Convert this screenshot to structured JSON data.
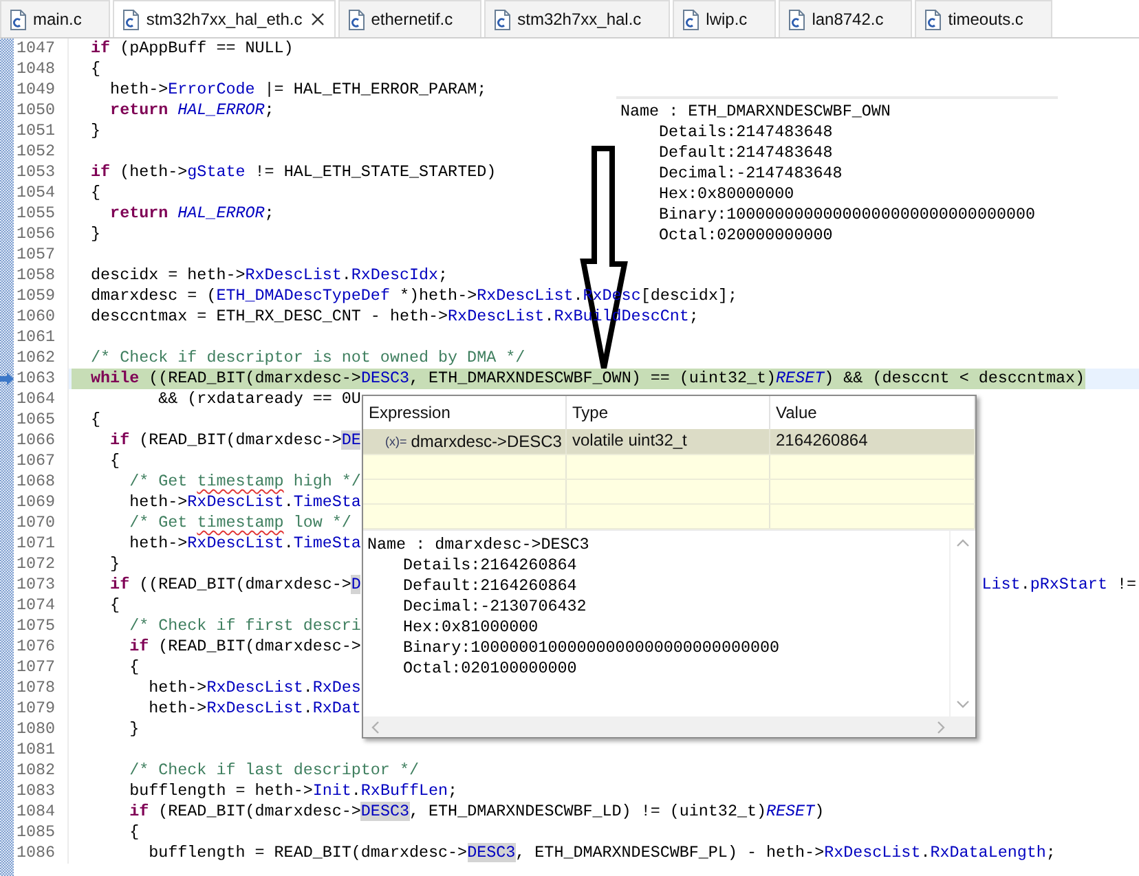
{
  "tabs": [
    {
      "label": "main.c",
      "selected": false
    },
    {
      "label": "stm32h7xx_hal_eth.c",
      "selected": true
    },
    {
      "label": "ethernetif.c",
      "selected": false
    },
    {
      "label": "stm32h7xx_hal.c",
      "selected": false
    },
    {
      "label": "lwip.c",
      "selected": false
    },
    {
      "label": "lan8742.c",
      "selected": false
    },
    {
      "label": "timeouts.c",
      "selected": false
    }
  ],
  "editor": {
    "lines": [
      {
        "number": "1047",
        "current": false,
        "segments": [
          {
            "text": "  if",
            "kind": "keyword"
          },
          {
            "text": " (pAppBuff == NULL)",
            "kind": "plain"
          }
        ]
      },
      {
        "number": "1048",
        "current": false,
        "segments": [
          {
            "text": "  {",
            "kind": "plain"
          }
        ]
      },
      {
        "number": "1049",
        "current": false,
        "segments": [
          {
            "text": "    heth->",
            "kind": "plain"
          },
          {
            "text": "ErrorCode",
            "kind": "field"
          },
          {
            "text": " |= HAL_ETH_ERROR_PARAM;",
            "kind": "plain"
          }
        ]
      },
      {
        "number": "1050",
        "current": false,
        "segments": [
          {
            "text": "    return ",
            "kind": "keyword"
          },
          {
            "text": "HAL_ERROR",
            "kind": "macro"
          },
          {
            "text": ";",
            "kind": "plain"
          }
        ]
      },
      {
        "number": "1051",
        "current": false,
        "segments": [
          {
            "text": "  }",
            "kind": "plain"
          }
        ]
      },
      {
        "number": "1052",
        "current": false
      },
      {
        "number": "1053",
        "current": false,
        "segments": [
          {
            "text": "  if",
            "kind": "keyword"
          },
          {
            "text": " (heth->",
            "kind": "plain"
          },
          {
            "text": "gState",
            "kind": "field"
          },
          {
            "text": " != HAL_ETH_STATE_STARTED)",
            "kind": "plain"
          }
        ]
      },
      {
        "number": "1054",
        "current": false,
        "segments": [
          {
            "text": "  {",
            "kind": "plain"
          }
        ]
      },
      {
        "number": "1055",
        "current": false,
        "segments": [
          {
            "text": "    return ",
            "kind": "keyword"
          },
          {
            "text": "HAL_ERROR",
            "kind": "macro"
          },
          {
            "text": ";",
            "kind": "plain"
          }
        ]
      },
      {
        "number": "1056",
        "current": false,
        "segments": [
          {
            "text": "  }",
            "kind": "plain"
          }
        ]
      },
      {
        "number": "1057",
        "current": false
      },
      {
        "number": "1058",
        "current": false,
        "segments": [
          {
            "text": "  descidx = heth->",
            "kind": "plain"
          },
          {
            "text": "RxDescList",
            "kind": "field"
          },
          {
            "text": ".",
            "kind": "plain"
          },
          {
            "text": "RxDescIdx",
            "kind": "field"
          },
          {
            "text": ";",
            "kind": "plain"
          }
        ]
      },
      {
        "number": "1059",
        "current": false,
        "segments": [
          {
            "text": "  dmarxdesc = (",
            "kind": "plain"
          },
          {
            "text": "ETH_DMADescTypeDef",
            "kind": "field"
          },
          {
            "text": " *)heth->",
            "kind": "plain"
          },
          {
            "text": "RxDescList",
            "kind": "field"
          },
          {
            "text": ".",
            "kind": "plain"
          },
          {
            "text": "RxDesc",
            "kind": "field"
          },
          {
            "text": "[descidx];",
            "kind": "plain"
          }
        ]
      },
      {
        "number": "1060",
        "current": false,
        "segments": [
          {
            "text": "  desccntmax = ETH_RX_DESC_CNT - heth->",
            "kind": "plain"
          },
          {
            "text": "RxDescList",
            "kind": "field"
          },
          {
            "text": ".",
            "kind": "plain"
          },
          {
            "text": "RxBuildDescCnt",
            "kind": "field"
          },
          {
            "text": ";",
            "kind": "plain"
          }
        ]
      },
      {
        "number": "1061",
        "current": false
      },
      {
        "number": "1062",
        "current": false,
        "segments": [
          {
            "text": "  /* Check if descriptor is not owned by DMA */",
            "kind": "comment"
          }
        ]
      },
      {
        "number": "1063",
        "current": true,
        "segments": [
          {
            "text": "  while",
            "kind": "keyword"
          },
          {
            "text": " ((READ_BIT(dmarxdesc->",
            "kind": "plain"
          },
          {
            "text": "DESC3",
            "kind": "field"
          },
          {
            "text": ", ETH_DMARXNDESCWBF_OWN) == (uint32_t)",
            "kind": "plain"
          },
          {
            "text": "RESET",
            "kind": "macro"
          },
          {
            "text": ") && (desccnt < desccntmax)",
            "kind": "plain"
          }
        ]
      },
      {
        "number": "1064",
        "current": false,
        "segments": [
          {
            "text": "         && (rxdataready == 0U",
            "kind": "plain"
          }
        ]
      },
      {
        "number": "1065",
        "current": false,
        "segments": [
          {
            "text": "  {",
            "kind": "plain"
          }
        ]
      },
      {
        "number": "1066",
        "current": false,
        "segments": [
          {
            "text": "    if",
            "kind": "keyword"
          },
          {
            "text": " (READ_BIT(dmarxdesc->",
            "kind": "plain"
          },
          {
            "text": "DE",
            "kind": "occurrence"
          }
        ]
      },
      {
        "number": "1067",
        "current": false,
        "segments": [
          {
            "text": "    {",
            "kind": "plain"
          }
        ]
      },
      {
        "number": "1068",
        "current": false,
        "segments": [
          {
            "text": "      /* Get ",
            "kind": "comment"
          },
          {
            "text": "timestamp",
            "kind": "misspelled"
          },
          {
            "text": " high */",
            "kind": "comment"
          }
        ]
      },
      {
        "number": "1069",
        "current": false,
        "segments": [
          {
            "text": "      heth->",
            "kind": "plain"
          },
          {
            "text": "RxDescList",
            "kind": "field"
          },
          {
            "text": ".",
            "kind": "plain"
          },
          {
            "text": "TimeSta",
            "kind": "field"
          }
        ]
      },
      {
        "number": "1070",
        "current": false,
        "segments": [
          {
            "text": "      /* Get ",
            "kind": "comment"
          },
          {
            "text": "timestamp",
            "kind": "misspelled"
          },
          {
            "text": " low */",
            "kind": "comment"
          }
        ]
      },
      {
        "number": "1071",
        "current": false,
        "segments": [
          {
            "text": "      heth->",
            "kind": "plain"
          },
          {
            "text": "RxDescList",
            "kind": "field"
          },
          {
            "text": ".",
            "kind": "plain"
          },
          {
            "text": "TimeSta",
            "kind": "field"
          }
        ]
      },
      {
        "number": "1072",
        "current": false,
        "segments": [
          {
            "text": "    }",
            "kind": "plain"
          }
        ]
      },
      {
        "number": "1073",
        "current": false,
        "segments": [
          {
            "text": "    if",
            "kind": "keyword"
          },
          {
            "text": " ((READ_BIT(dmarxdesc->",
            "kind": "plain"
          },
          {
            "text": "D",
            "kind": "occurrence"
          }
        ],
        "tail": [
          {
            "text": "List",
            "kind": "field"
          },
          {
            "text": ".",
            "kind": "plain"
          },
          {
            "text": "pRxStart",
            "kind": "field"
          },
          {
            "text": " !=",
            "kind": "plain"
          }
        ]
      },
      {
        "number": "1074",
        "current": false,
        "segments": [
          {
            "text": "    {",
            "kind": "plain"
          }
        ]
      },
      {
        "number": "1075",
        "current": false,
        "segments": [
          {
            "text": "      /* Check if first descri",
            "kind": "comment"
          }
        ]
      },
      {
        "number": "1076",
        "current": false,
        "segments": [
          {
            "text": "      if",
            "kind": "keyword"
          },
          {
            "text": " (READ_BIT(dmarxdesc->",
            "kind": "plain"
          }
        ]
      },
      {
        "number": "1077",
        "current": false,
        "segments": [
          {
            "text": "      {",
            "kind": "plain"
          }
        ]
      },
      {
        "number": "1078",
        "current": false,
        "segments": [
          {
            "text": "        heth->",
            "kind": "plain"
          },
          {
            "text": "RxDescList",
            "kind": "field"
          },
          {
            "text": ".",
            "kind": "plain"
          },
          {
            "text": "RxDes",
            "kind": "field"
          }
        ]
      },
      {
        "number": "1079",
        "current": false,
        "segments": [
          {
            "text": "        heth->",
            "kind": "plain"
          },
          {
            "text": "RxDescList",
            "kind": "field"
          },
          {
            "text": ".",
            "kind": "plain"
          },
          {
            "text": "RxDat",
            "kind": "field"
          }
        ]
      },
      {
        "number": "1080",
        "current": false,
        "segments": [
          {
            "text": "      }",
            "kind": "plain"
          }
        ]
      },
      {
        "number": "1081",
        "current": false
      },
      {
        "number": "1082",
        "current": false,
        "segments": [
          {
            "text": "      /* Check if last descriptor */",
            "kind": "comment"
          }
        ]
      },
      {
        "number": "1083",
        "current": false,
        "segments": [
          {
            "text": "      bufflength = heth->",
            "kind": "plain"
          },
          {
            "text": "Init",
            "kind": "field"
          },
          {
            "text": ".",
            "kind": "plain"
          },
          {
            "text": "RxBuffLen",
            "kind": "field"
          },
          {
            "text": ";",
            "kind": "plain"
          }
        ]
      },
      {
        "number": "1084",
        "current": false,
        "segments": [
          {
            "text": "      if",
            "kind": "keyword"
          },
          {
            "text": " (READ_BIT(dmarxdesc->",
            "kind": "plain"
          },
          {
            "text": "DESC3",
            "kind": "occurrence"
          },
          {
            "text": ", ETH_DMARXNDESCWBF_LD) != (uint32_t)",
            "kind": "plain"
          },
          {
            "text": "RESET",
            "kind": "macro"
          },
          {
            "text": ")",
            "kind": "plain"
          }
        ]
      },
      {
        "number": "1085",
        "current": false,
        "segments": [
          {
            "text": "      {",
            "kind": "plain"
          }
        ]
      },
      {
        "number": "1086",
        "current": false,
        "segments": [
          {
            "text": "        bufflength = READ_BIT(dmarxdesc->",
            "kind": "plain"
          },
          {
            "text": "DESC3",
            "kind": "occurrence"
          },
          {
            "text": ", ETH_DMARXNDESCWBF_PL) - heth->",
            "kind": "plain"
          },
          {
            "text": "RxDescList",
            "kind": "field"
          },
          {
            "text": ".",
            "kind": "plain"
          },
          {
            "text": "RxDataLength",
            "kind": "field"
          },
          {
            "text": ";",
            "kind": "plain"
          }
        ]
      }
    ]
  },
  "hover_info": {
    "title": "Name : ETH_DMARXNDESCWBF_OWN",
    "details": [
      "Details:2147483648",
      "Default:2147483648",
      "Decimal:-2147483648",
      "Hex:0x80000000",
      "Binary:10000000000000000000000000000000",
      "Octal:020000000000"
    ]
  },
  "expression_popup": {
    "columns": [
      "Expression",
      "Type",
      "Value"
    ],
    "rows": [
      {
        "icon": "(x)=",
        "expression": "dmarxdesc->DESC3",
        "type": "volatile uint32_t",
        "value": "2164260864",
        "selected": true
      }
    ],
    "details_title": "Name : dmarxdesc->DESC3",
    "details": [
      "Details:2164260864",
      "Default:2164260864",
      "Decimal:-2130706432",
      "Hex:0x81000000",
      "Binary:10000001000000000000000000000000",
      "Octal:020100000000"
    ]
  }
}
